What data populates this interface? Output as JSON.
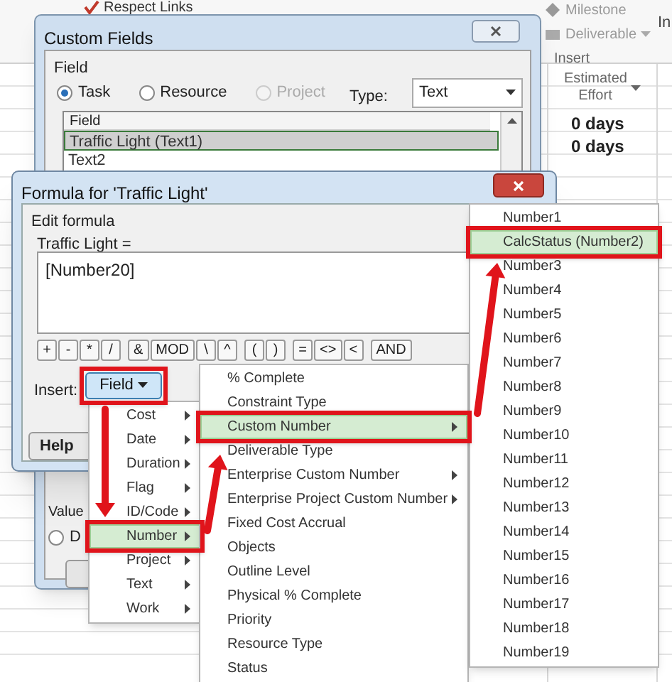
{
  "ribbon": {
    "items": [
      {
        "label": "Respect Links",
        "kind": "link"
      },
      {
        "label": "Milestone",
        "kind": "milestone"
      },
      {
        "label": "Deliverable",
        "kind": "deliverable"
      }
    ],
    "group_label": "Insert",
    "cut_label": "In"
  },
  "table": {
    "column": "Estimated Effort",
    "rows": [
      "0 days",
      "0 days"
    ]
  },
  "custom_fields": {
    "title": "Custom Fields",
    "group": "Field",
    "radios": [
      {
        "label": "Task",
        "selected": true,
        "disabled": false
      },
      {
        "label": "Resource",
        "selected": false,
        "disabled": false
      },
      {
        "label": "Project",
        "selected": false,
        "disabled": true
      }
    ],
    "type_label": "Type:",
    "type_value": "Text",
    "list_header": "Field",
    "rows": [
      {
        "label": "Traffic Light (Text1)",
        "selected": true
      },
      {
        "label": "Text2",
        "selected": false
      }
    ],
    "values_label": "Value",
    "value_radio": {
      "label": "D",
      "selected": false
    }
  },
  "formula": {
    "title": "Formula for 'Traffic Light'",
    "group": "Edit formula",
    "field_label": "Traffic Light =",
    "formula": "[Number20]",
    "operators": [
      [
        "+",
        "-",
        "*",
        "/"
      ],
      [
        "&",
        "MOD",
        "\\",
        "^"
      ],
      [
        "(",
        ")"
      ],
      [
        "=",
        "<>",
        "<"
      ],
      [
        "AND"
      ]
    ],
    "insert_label": "Insert:",
    "field_button": "Field",
    "help": "Help"
  },
  "field_menu": [
    {
      "label": "Cost",
      "selected": false
    },
    {
      "label": "Date",
      "selected": false
    },
    {
      "label": "Duration",
      "selected": false
    },
    {
      "label": "Flag",
      "selected": false
    },
    {
      "label": "ID/Code",
      "selected": false
    },
    {
      "label": "Number",
      "selected": true
    },
    {
      "label": "Project",
      "selected": false
    },
    {
      "label": "Text",
      "selected": false
    },
    {
      "label": "Work",
      "selected": false
    }
  ],
  "field_submenu": [
    {
      "label": "% Complete",
      "selected": false,
      "submenu": false
    },
    {
      "label": "Constraint Type",
      "selected": false,
      "submenu": false
    },
    {
      "label": "Custom Number",
      "selected": true,
      "submenu": true
    },
    {
      "label": "Deliverable Type",
      "selected": false,
      "submenu": false
    },
    {
      "label": "Enterprise Custom Number",
      "selected": false,
      "submenu": true
    },
    {
      "label": "Enterprise Project Custom Number",
      "selected": false,
      "submenu": true
    },
    {
      "label": "Fixed Cost Accrual",
      "selected": false,
      "submenu": false
    },
    {
      "label": "Objects",
      "selected": false,
      "submenu": false
    },
    {
      "label": "Outline Level",
      "selected": false,
      "submenu": false
    },
    {
      "label": "Physical % Complete",
      "selected": false,
      "submenu": false
    },
    {
      "label": "Priority",
      "selected": false,
      "submenu": false
    },
    {
      "label": "Resource Type",
      "selected": false,
      "submenu": false
    },
    {
      "label": "Status",
      "selected": false,
      "submenu": false
    }
  ],
  "number_menu": [
    {
      "label": "Number1",
      "selected": false
    },
    {
      "label": "CalcStatus (Number2)",
      "selected": true
    },
    {
      "label": "Number3",
      "selected": false
    },
    {
      "label": "Number4",
      "selected": false
    },
    {
      "label": "Number5",
      "selected": false
    },
    {
      "label": "Number6",
      "selected": false
    },
    {
      "label": "Number7",
      "selected": false
    },
    {
      "label": "Number8",
      "selected": false
    },
    {
      "label": "Number9",
      "selected": false
    },
    {
      "label": "Number10",
      "selected": false
    },
    {
      "label": "Number11",
      "selected": false
    },
    {
      "label": "Number12",
      "selected": false
    },
    {
      "label": "Number13",
      "selected": false
    },
    {
      "label": "Number14",
      "selected": false
    },
    {
      "label": "Number15",
      "selected": false
    },
    {
      "label": "Number16",
      "selected": false
    },
    {
      "label": "Number17",
      "selected": false
    },
    {
      "label": "Number18",
      "selected": false
    },
    {
      "label": "Number19",
      "selected": false
    }
  ]
}
